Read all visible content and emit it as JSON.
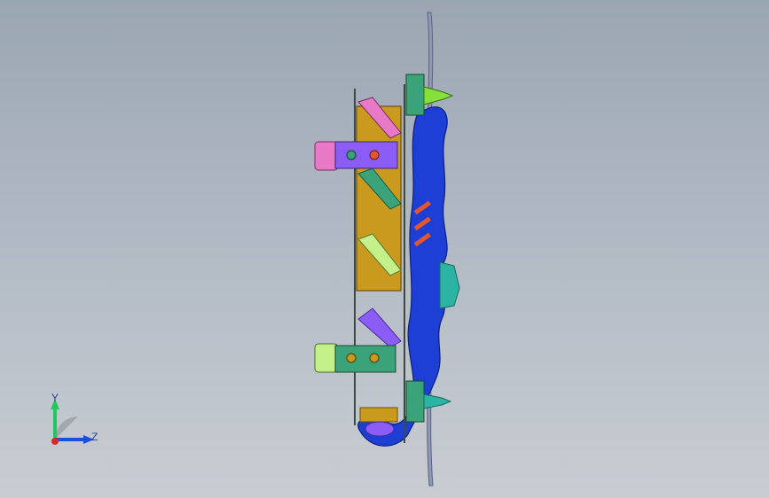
{
  "viewport": {
    "background_top": "#9ba6b3",
    "background_bottom": "#c8cdd2"
  },
  "triad": {
    "y_label": "Y",
    "z_label": "Z",
    "y_color": "#22c55e",
    "z_color": "#1d4ed8",
    "origin_color": "#dc2626"
  },
  "model": {
    "description_colors": {
      "frame_blue": "#1d3fd6",
      "battery_gold": "#c99a1d",
      "motor_green": "#3aa37a",
      "propeller_gray": "#8f98b4",
      "accent_pink": "#e879c7",
      "accent_purple": "#8b5cf6",
      "accent_lime": "#c4f08a",
      "accent_orange": "#e4572e",
      "teal": "#2bb3a3"
    }
  }
}
